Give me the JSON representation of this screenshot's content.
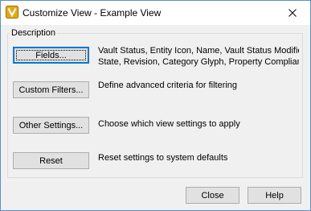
{
  "window": {
    "title": "Customize View - Example View",
    "accent_color": "#0078d7",
    "icon": "vault-app-icon"
  },
  "group": {
    "label": "Description"
  },
  "rows": [
    {
      "button_label": "Fields...",
      "description_lines": [
        "Vault Status, Entity Icon, Name, Vault Status Modifier,",
        "State, Revision, Category Glyph, Property Compliance,..."
      ]
    },
    {
      "button_label": "Custom Filters...",
      "description_lines": [
        "Define advanced criteria for filtering"
      ]
    },
    {
      "button_label": "Other Settings...",
      "description_lines": [
        "Choose which view settings to apply"
      ]
    },
    {
      "button_label": "Reset",
      "description_lines": [
        "Reset settings to system defaults"
      ]
    }
  ],
  "footer": {
    "close_label": "Close",
    "help_label": "Help"
  }
}
